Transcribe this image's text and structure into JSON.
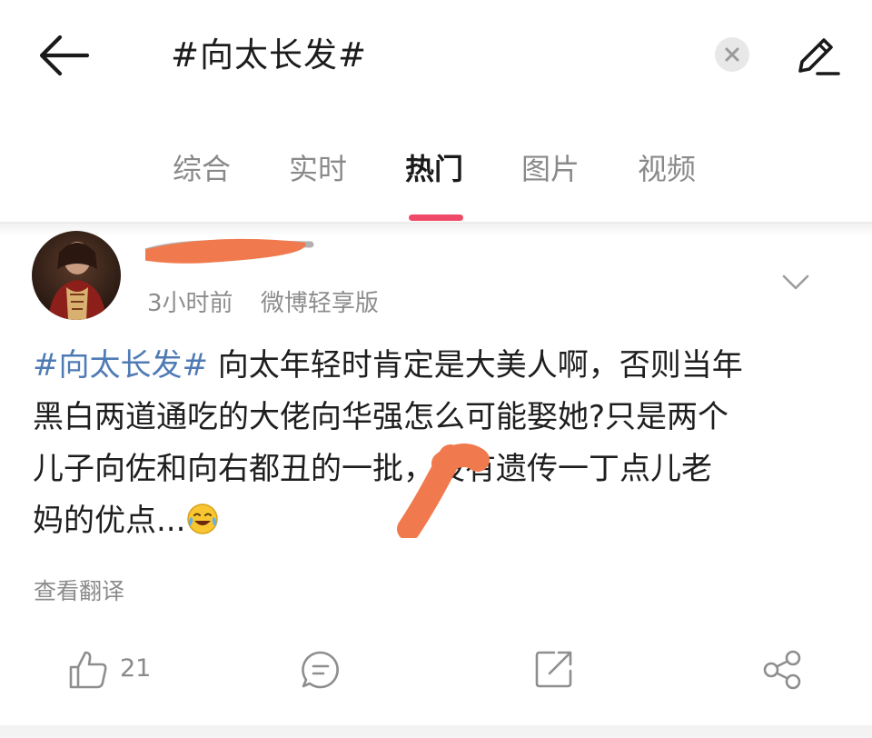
{
  "search": {
    "query": "#向太长发#"
  },
  "tabs": [
    {
      "label": "综合",
      "active": false
    },
    {
      "label": "实时",
      "active": false
    },
    {
      "label": "热门",
      "active": true
    },
    {
      "label": "图片",
      "active": false
    },
    {
      "label": "视频",
      "active": false
    }
  ],
  "post": {
    "time": "3小时前",
    "source": "微博轻享版",
    "hashtag": "#向太长发#",
    "lines": [
      " 向太年轻时肯定是大美人啊，否则当年",
      "黑白两道通吃的大佬向华强怎么可能娶她?只是两个",
      "儿子向佐和向右都丑的一批，没有遗传一丁点儿老",
      "妈的优点..."
    ],
    "translate_label": "查看翻译",
    "like_count": "21"
  },
  "icons": {
    "back": "arrow-left-icon",
    "clear": "clear-x-icon",
    "edit": "pencil-icon",
    "more": "chevron-down-icon",
    "like": "thumbs-up-icon",
    "comment": "comment-bubble-icon",
    "repost": "repost-arrow-icon",
    "share": "share-nodes-icon",
    "emoji": "laughing-tears-emoji"
  },
  "colors": {
    "accent": "#ef4b68",
    "hashtag": "#4f7bb5",
    "redaction": "#f07a4e"
  }
}
